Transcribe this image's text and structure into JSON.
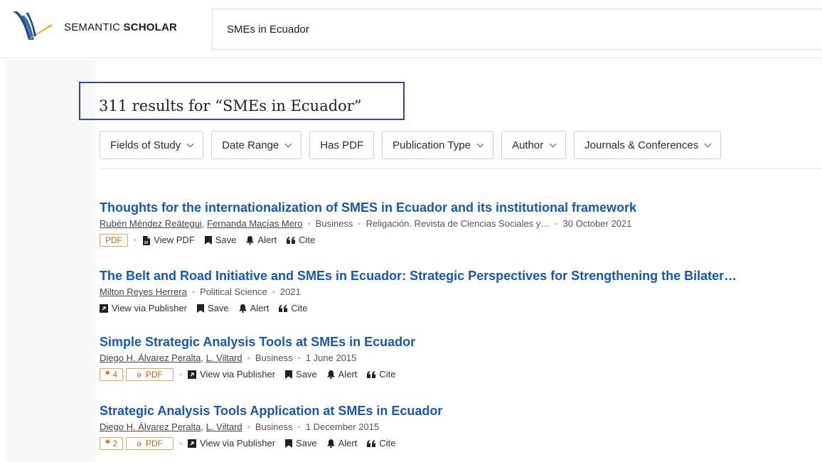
{
  "brand": {
    "prefix": "SEMANTIC ",
    "bold": "SCHOLAR"
  },
  "search": {
    "value": "SMEs in Ecuador"
  },
  "results_heading": "311 results for “SMEs in Ecuador”",
  "filters": [
    {
      "label": "Fields of Study",
      "dropdown": true
    },
    {
      "label": "Date Range",
      "dropdown": true
    },
    {
      "label": "Has PDF",
      "dropdown": false
    },
    {
      "label": "Publication Type",
      "dropdown": true
    },
    {
      "label": "Author",
      "dropdown": true
    },
    {
      "label": "Journals & Conferences",
      "dropdown": true
    }
  ],
  "results": [
    {
      "title": "Thoughts for the internationalization of SMES in Ecuador and its institutional framework",
      "authors": [
        "Rubén Méndez Reátegui",
        "Fernanda Macías Mero"
      ],
      "field": "Business",
      "venue": "Religación. Revista de Ciencias Sociales y…",
      "date": "30 October 2021",
      "badges": {
        "pdf": "PDF"
      },
      "actions": {
        "view": "View PDF",
        "save": "Save",
        "alert": "Alert",
        "cite": "Cite"
      }
    },
    {
      "title": "The Belt and Road Initiative and SMEs in Ecuador: Strategic Perspectives for Strengthening the Bilater…",
      "authors": [
        "Milton Reyes Herrera"
      ],
      "field": "Political Science",
      "date": "2021",
      "actions": {
        "view": "View via Publisher",
        "save": "Save",
        "alert": "Alert",
        "cite": "Cite"
      }
    },
    {
      "title": "Simple Strategic Analysis Tools at SMEs in Ecuador",
      "authors": [
        "Diego H. Álvarez Peralta",
        "L. Viltard"
      ],
      "field": "Business",
      "date": "1 June 2015",
      "badges": {
        "citations": "4",
        "pdf": "PDF"
      },
      "actions": {
        "view": "View via Publisher",
        "save": "Save",
        "alert": "Alert",
        "cite": "Cite"
      }
    },
    {
      "title": "Strategic Analysis Tools Application at SMEs in Ecuador",
      "authors": [
        "Diego H. Álvarez Peralta",
        "L. Viltard"
      ],
      "field": "Business",
      "date": "1 December 2015",
      "badges": {
        "citations": "2",
        "pdf": "PDF"
      },
      "actions": {
        "view": "View via Publisher",
        "save": "Save",
        "alert": "Alert",
        "cite": "Cite"
      }
    }
  ],
  "colors": {
    "link": "#1857b6",
    "accent_box": "#3342b8",
    "pdf_badge": "#c8641a",
    "logo_blue": "#1d4f8f",
    "logo_gold": "#f2b01e"
  },
  "icons": [
    "logo-icon",
    "chevron-down-icon",
    "pdf-file-icon",
    "bookmark-icon",
    "bell-icon",
    "quote-icon",
    "external-link-icon",
    "open-access-icon"
  ]
}
